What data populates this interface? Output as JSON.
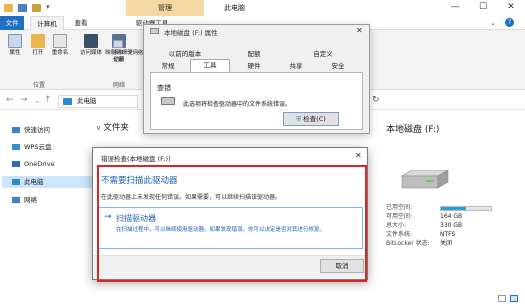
{
  "window": {
    "file_label": "文件",
    "manage_label": "管理",
    "title": "此电脑",
    "minimize": "—",
    "maximize": "☐",
    "close": "✕"
  },
  "ribbon": {
    "tabs": [
      "计算机",
      "查看",
      "驱动器工具"
    ],
    "buttons": [
      "属性",
      "打开",
      "重命名",
      "访问媒体",
      "映射网络驱动器",
      "添加一个网络位置"
    ],
    "groups": [
      "位置",
      "网络"
    ]
  },
  "address": {
    "path": "此电脑",
    "folders_header": "文件夹"
  },
  "nav": {
    "items": [
      "快速访问",
      "WPS云盘",
      "OneDrive",
      "此电脑",
      "网络"
    ]
  },
  "details": {
    "title": "本地磁盘 (F:)",
    "labels": [
      "已用空间:",
      "可用空间:",
      "总大小:",
      "文件系统:",
      "BitLocker 状态:"
    ],
    "values": [
      "",
      "164 GB",
      "330 GB",
      "NTFS",
      "关闭"
    ]
  },
  "properties": {
    "title": "本地磁盘 (F:) 属性",
    "tabs_row1": [
      "以前的版本",
      "配额",
      "自定义"
    ],
    "tabs_row2": [
      "常规",
      "工具",
      "硬件",
      "共享",
      "安全"
    ],
    "section": "查错",
    "desc": "此选项将检查驱动器中的文件系统错误。",
    "check_button": "检查(C)"
  },
  "errorcheck": {
    "title": "错误检查(本地磁盘 (F:))",
    "heading": "不需要扫描此驱动器",
    "desc": "在此驱动器上未发现任何错误。如果需要，可以继续扫描该驱动器。",
    "option_title": "扫描驱动器",
    "option_desc": "在扫描过程中，可以继续使用驱动器。如果发现错误，你可以决定是否对其进行修复。",
    "cancel": "取消"
  },
  "colors": {
    "accent": "#1f6fc5",
    "highlight": "#e02424",
    "heading_blue": "#1a5fb4",
    "bar_fill": "#26a0da"
  },
  "usage_fraction": 0.5
}
